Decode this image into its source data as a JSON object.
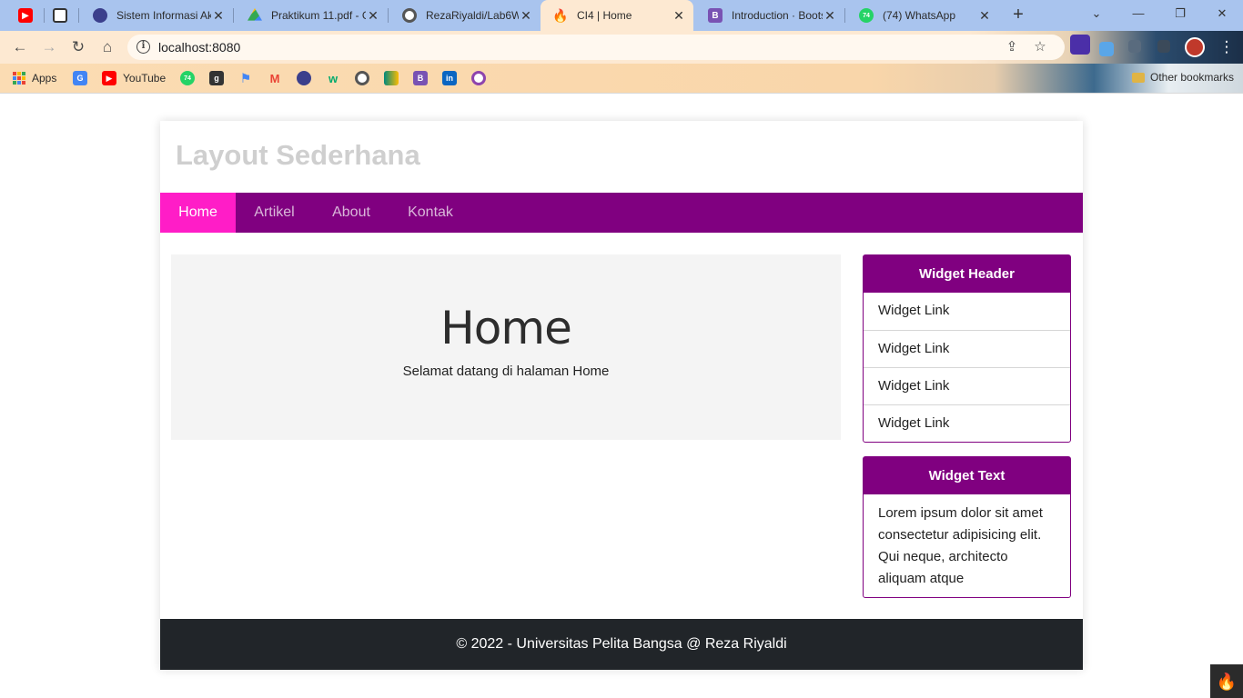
{
  "browser": {
    "tabs": [
      {
        "title": "",
        "icon": "youtube-icon",
        "color": "#ff0000"
      },
      {
        "title": "",
        "icon": "grid-icon",
        "color": "#333333"
      },
      {
        "title": "Sistem Informasi Ak",
        "icon": "university-icon",
        "color": "#3b3f8c"
      },
      {
        "title": "Praktikum 11.pdf - G",
        "icon": "drive-icon",
        "color": "#1fa463"
      },
      {
        "title": "RezaRiyaldi/Lab6W",
        "icon": "github-icon",
        "color": "#ffffff"
      },
      {
        "title": "CI4 | Home",
        "icon": "codeigniter-icon",
        "color": "#dd4814"
      },
      {
        "title": "Introduction · Boots",
        "icon": "bootstrap-icon",
        "color": "#7952b3"
      },
      {
        "title": "(74) WhatsApp",
        "icon": "whatsapp-icon",
        "color": "#25d366"
      }
    ],
    "url": "localhost:8080",
    "bookmarks": [
      {
        "label": "Apps",
        "icon": "apps-grid-icon"
      },
      {
        "label": "",
        "icon": "google-translate-icon",
        "color": "#4285f4"
      },
      {
        "label": "YouTube",
        "icon": "youtube-icon",
        "color": "#ff0000"
      },
      {
        "label": "",
        "icon": "whatsapp-icon",
        "color": "#25d366"
      },
      {
        "label": "",
        "icon": "goodreads-icon",
        "color": "#333333"
      },
      {
        "label": "",
        "icon": "flag-icon",
        "color": "#4285f4"
      },
      {
        "label": "",
        "icon": "gmail-icon",
        "color": "#ea4335"
      },
      {
        "label": "",
        "icon": "university-icon",
        "color": "#3b3f8c"
      },
      {
        "label": "",
        "icon": "w3schools-icon",
        "color": "#04aa6d"
      },
      {
        "label": "",
        "icon": "github-icon",
        "color": "#ffffff"
      },
      {
        "label": "",
        "icon": "meet-icon",
        "color": "#00897b"
      },
      {
        "label": "",
        "icon": "bootstrap-icon",
        "color": "#7952b3"
      },
      {
        "label": "",
        "icon": "linkedin-icon",
        "color": "#0a66c2"
      },
      {
        "label": "",
        "icon": "search-lens-icon",
        "color": "#8e44ad"
      }
    ],
    "other_bookmarks": "Other bookmarks"
  },
  "site": {
    "title": "Layout Sederhana",
    "nav": [
      "Home",
      "Artikel",
      "About",
      "Kontak"
    ],
    "active_nav": "Home",
    "hero": {
      "title": "Home",
      "subtitle": "Selamat datang di halaman Home"
    },
    "widget1": {
      "header": "Widget Header",
      "links": [
        "Widget Link",
        "Widget Link",
        "Widget Link",
        "Widget Link"
      ]
    },
    "widget2": {
      "header": "Widget Text",
      "text": "Lorem ipsum dolor sit amet consectetur adipisicing elit. Qui neque, architecto aliquam atque"
    },
    "footer": "© 2022 - Universitas Pelita Bangsa @ Reza Riyaldi"
  },
  "colors": {
    "nav": "#800080",
    "nav_active": "#ff1dc7",
    "footer": "#212529"
  }
}
